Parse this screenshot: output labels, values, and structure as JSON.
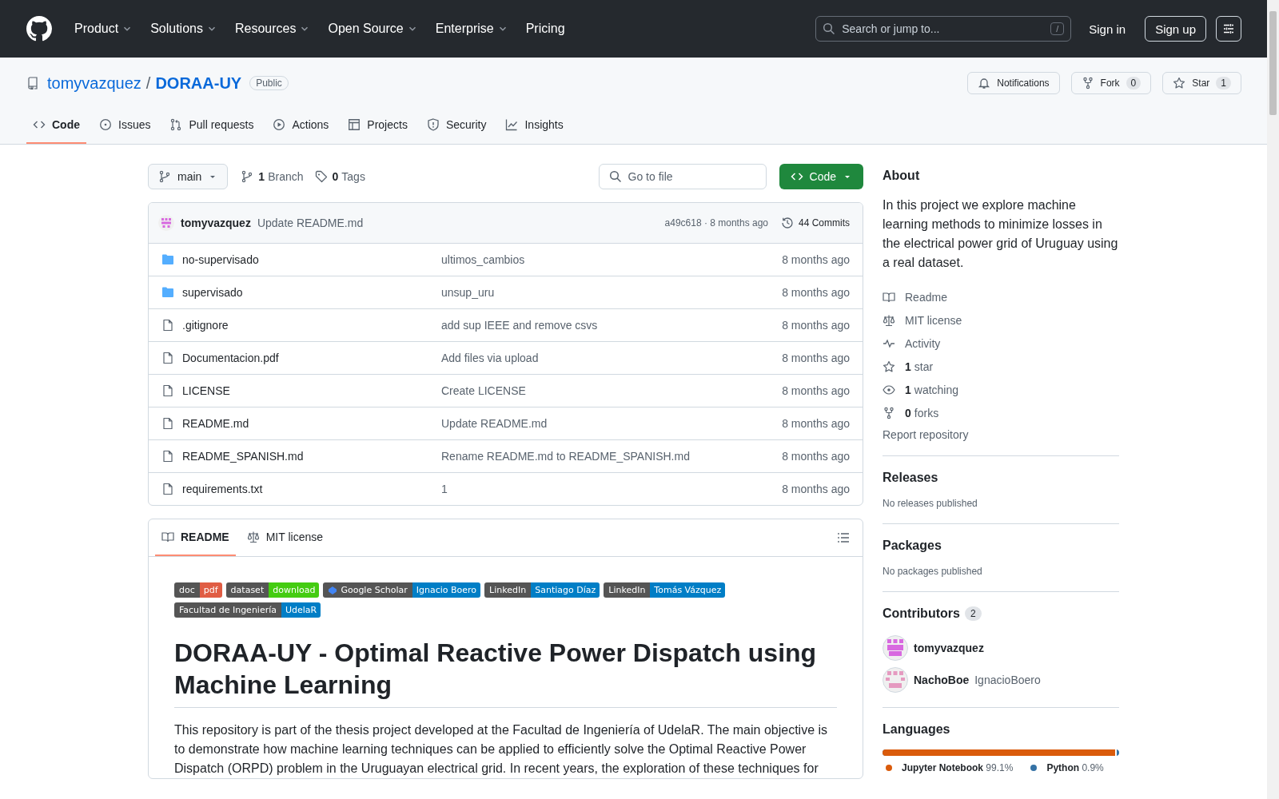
{
  "nav": {
    "items": [
      {
        "label": "Product",
        "dropdown": true
      },
      {
        "label": "Solutions",
        "dropdown": true
      },
      {
        "label": "Resources",
        "dropdown": true
      },
      {
        "label": "Open Source",
        "dropdown": true
      },
      {
        "label": "Enterprise",
        "dropdown": true
      },
      {
        "label": "Pricing",
        "dropdown": false
      }
    ],
    "search": {
      "placeholder": "Search or jump to...",
      "shortcut": "/"
    },
    "sign_in": "Sign in",
    "sign_up": "Sign up"
  },
  "repo": {
    "owner": "tomyvazquez",
    "separator": "/",
    "name": "DORAA-UY",
    "visibility": "Public",
    "actions": [
      {
        "kind": "bell",
        "label": "Notifications"
      },
      {
        "kind": "fork",
        "label": "Fork",
        "count": "0"
      },
      {
        "kind": "star",
        "label": "Star",
        "count": "1"
      }
    ],
    "tabs": [
      {
        "kind": "code",
        "label": "Code",
        "selected": true
      },
      {
        "kind": "issues",
        "label": "Issues",
        "selected": false
      },
      {
        "kind": "pr",
        "label": "Pull requests",
        "selected": false
      },
      {
        "kind": "actions",
        "label": "Actions",
        "selected": false
      },
      {
        "kind": "projects",
        "label": "Projects",
        "selected": false
      },
      {
        "kind": "security",
        "label": "Security",
        "selected": false
      },
      {
        "kind": "insights",
        "label": "Insights",
        "selected": false
      }
    ]
  },
  "toolbar": {
    "branch": "main",
    "branches_count": "1",
    "branches_label": "Branch",
    "tags_count": "0",
    "tags_label": "Tags",
    "go_to_file": {
      "placeholder": "Go to file"
    },
    "code_button": "Code"
  },
  "commit": {
    "author": "tomyvazquez",
    "message": "Update README.md",
    "hash": "a49c618 · 8 months ago",
    "commits": "44 Commits"
  },
  "files": [
    {
      "kind": "folder",
      "name": "no-supervisado",
      "message": "ultimos_cambios",
      "time": "8 months ago"
    },
    {
      "kind": "folder",
      "name": "supervisado",
      "message": "unsup_uru",
      "time": "8 months ago"
    },
    {
      "kind": "file",
      "name": ".gitignore",
      "message": "add sup IEEE and remove csvs",
      "time": "8 months ago"
    },
    {
      "kind": "file",
      "name": "Documentacion.pdf",
      "message": "Add files via upload",
      "time": "8 months ago"
    },
    {
      "kind": "file",
      "name": "LICENSE",
      "message": "Create LICENSE",
      "time": "8 months ago"
    },
    {
      "kind": "file",
      "name": "README.md",
      "message": "Update README.md",
      "time": "8 months ago"
    },
    {
      "kind": "file",
      "name": "README_SPANISH.md",
      "message": "Rename README.md to README_SPANISH.md",
      "time": "8 months ago"
    },
    {
      "kind": "file",
      "name": "requirements.txt",
      "message": "1",
      "time": "8 months ago"
    }
  ],
  "readme": {
    "tabs": [
      {
        "kind": "book",
        "label": "README",
        "selected": true
      },
      {
        "kind": "law",
        "label": "MIT license",
        "selected": false
      }
    ],
    "badges": [
      {
        "kind": "plain",
        "label": "doc",
        "value": "pdf",
        "color": "#e05d44"
      },
      {
        "kind": "plain",
        "label": "dataset",
        "value": "download",
        "color": "#44cc11"
      },
      {
        "kind": "scholar",
        "label": "Google Scholar",
        "value": "Ignacio Boero",
        "color": "#007ec6"
      },
      {
        "kind": "plain",
        "label": "LinkedIn",
        "value": "Santiago Díaz",
        "color": "#007ec6"
      },
      {
        "kind": "plain",
        "label": "LinkedIn",
        "value": "Tomás Vázquez",
        "color": "#007ec6"
      },
      {
        "kind": "plain",
        "label": "Facultad de Ingeniería",
        "value": "UdelaR",
        "color": "#007ec6"
      }
    ],
    "title": "DORAA-UY - Optimal Reactive Power Dispatch using Machine Learning",
    "paragraph": "This repository is part of the thesis project developed at the Facultad de Ingeniería of UdelaR. The main objective is to demonstrate how machine learning techniques can be applied to efficiently solve the Optimal Reactive Power Dispatch (ORPD) problem in the Uruguayan electrical grid. In recent years, the exploration of these techniques for"
  },
  "about": {
    "title": "About",
    "description": "In this project we explore machine learning methods to minimize losses in the electrical power grid of Uruguay using a real dataset.",
    "links": [
      {
        "kind": "book",
        "label": "Readme"
      },
      {
        "kind": "law",
        "label": "MIT license"
      },
      {
        "kind": "pulse",
        "label": "Activity"
      },
      {
        "kind": "star",
        "count": "1",
        "label": "star"
      },
      {
        "kind": "eye",
        "count": "1",
        "label": "watching"
      },
      {
        "kind": "fork",
        "count": "0",
        "label": "forks"
      }
    ],
    "report": "Report repository"
  },
  "releases": {
    "title": "Releases",
    "note": "No releases published"
  },
  "packages": {
    "title": "Packages",
    "note": "No packages published"
  },
  "contributors": {
    "title": "Contributors",
    "count": "2",
    "people": [
      {
        "login": "tomyvazquez",
        "color": "#d869e0"
      },
      {
        "login": "NachoBoe",
        "name": "IgnacioBoero",
        "color": "#e59ac0"
      }
    ]
  },
  "languages": {
    "title": "Languages",
    "items": [
      {
        "name": "Jupyter Notebook",
        "percent": "99.1%",
        "level": 0.991,
        "color": "#da5b0b"
      },
      {
        "name": "Python",
        "percent": "0.9%",
        "color": "#3572a5"
      }
    ]
  }
}
